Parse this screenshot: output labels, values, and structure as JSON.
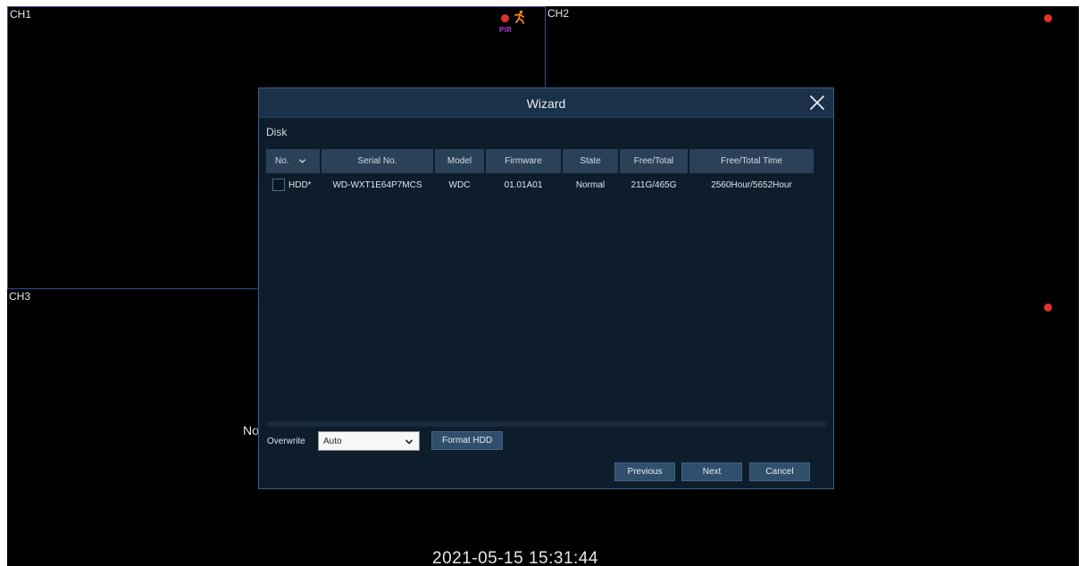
{
  "channels": [
    {
      "label": "CH1",
      "recording": true
    },
    {
      "label": "CH2",
      "recording": true
    },
    {
      "label": "CH3",
      "recording": false
    },
    {
      "label": "",
      "recording": true
    }
  ],
  "ch1_alert": {
    "icon": "motion-person-icon",
    "tag": "PIR"
  },
  "no_video_text": "No",
  "timestamp": "2021-05-15 15:31:44",
  "colors": {
    "record": "#e0322c",
    "motion": "#f08a1c",
    "pir": "#b13fd1",
    "dialog_bg": "#0d1d2c",
    "header_bg": "#2a4157"
  },
  "dialog": {
    "title": "Wizard",
    "section": "Disk",
    "table": {
      "columns": [
        "No.",
        "Serial No.",
        "Model",
        "Firmware",
        "State",
        "Free/Total",
        "Free/Total Time"
      ],
      "rows": [
        {
          "no": "HDD*",
          "serial": "WD-WXT1E64P7MCS",
          "model": "WDC",
          "firmware": "01.01A01",
          "state": "Normal",
          "free_total": "211G/465G",
          "free_total_time": "2560Hour/5652Hour",
          "checked": false
        }
      ]
    },
    "overwrite": {
      "label": "Overwrite",
      "value": "Auto"
    },
    "buttons": {
      "format": "Format HDD",
      "previous": "Previous",
      "next": "Next",
      "cancel": "Cancel"
    }
  }
}
